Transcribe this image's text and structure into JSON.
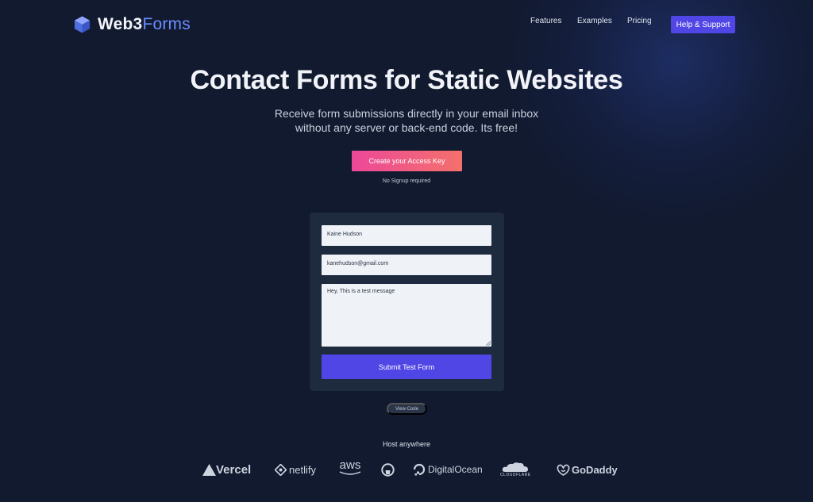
{
  "header": {
    "logo_part1": "Web3",
    "logo_part2": "Forms",
    "nav": [
      "Features",
      "Examples",
      "Pricing"
    ],
    "help_label": "Help & Support"
  },
  "hero": {
    "title": "Contact Forms for Static Websites",
    "subtitle_line1": "Receive form submissions directly in your email inbox",
    "subtitle_line2": "without any server or back-end code. Its free!",
    "cta_label": "Create your Access Key",
    "cta_note": "No Signup required"
  },
  "demo_form": {
    "name_value": "Kaine Hudson",
    "email_value": "kanehudson@gmail.com",
    "message_value": "Hey, This is a test message",
    "submit_label": "Submit Test Form"
  },
  "view_code_label": "View Code",
  "hosts": {
    "title": "Host anywhere",
    "vercel": "Vercel",
    "netlify": "netlify",
    "aws": "aws",
    "digitalocean": "DigitalOcean",
    "cloudflare": "CLOUDFLARE",
    "godaddy": "GoDaddy"
  },
  "colors": {
    "background": "#111a2f",
    "accent": "#5046e5",
    "cta_gradient_start": "#ec4899",
    "cta_gradient_end": "#f4716b",
    "logo_accent": "#6b8cff"
  },
  "icons": [
    "cube-logo-icon",
    "vercel-icon",
    "netlify-icon",
    "aws-icon",
    "github-icon",
    "digitalocean-icon",
    "cloudflare-icon",
    "godaddy-icon"
  ]
}
